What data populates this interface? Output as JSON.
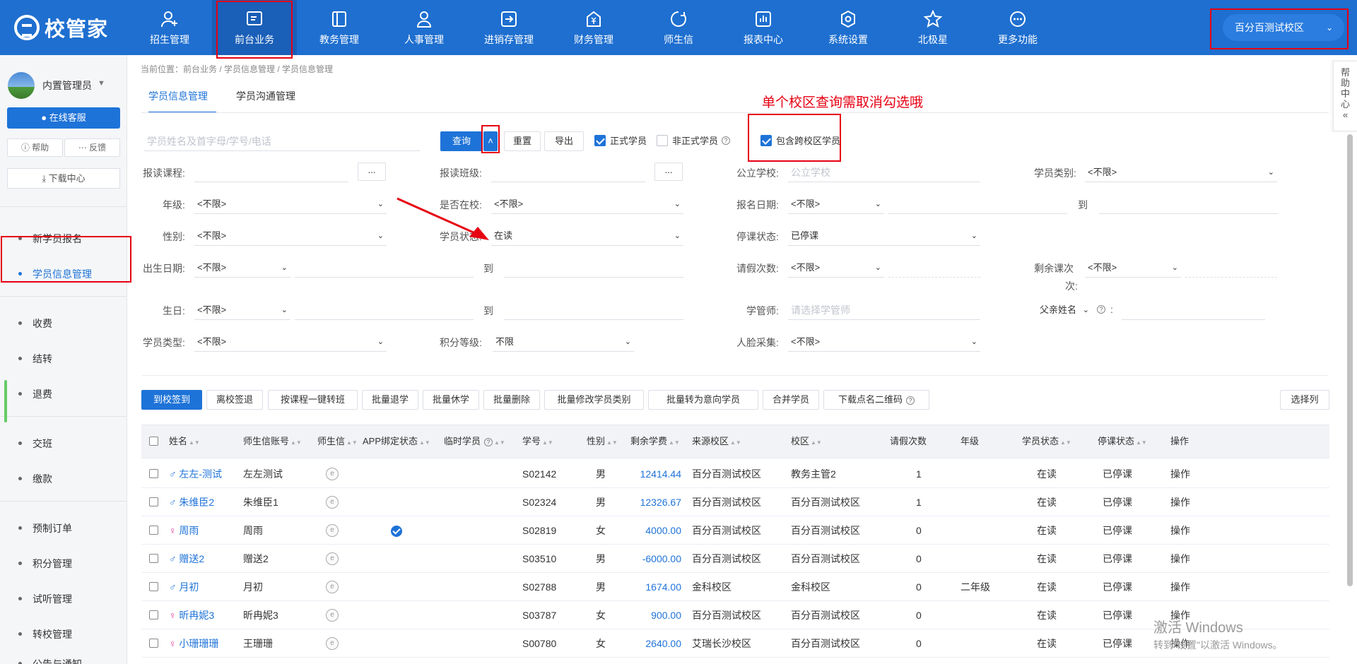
{
  "app": {
    "logo_text": "校管家"
  },
  "nav": [
    {
      "label": "招生管理",
      "icon": "person-add-icon"
    },
    {
      "label": "前台业务",
      "icon": "front-desk-icon",
      "active": true
    },
    {
      "label": "教务管理",
      "icon": "book-icon"
    },
    {
      "label": "人事管理",
      "icon": "person-icon"
    },
    {
      "label": "进销存管理",
      "icon": "inventory-icon"
    },
    {
      "label": "财务管理",
      "icon": "finance-icon"
    },
    {
      "label": "师生信",
      "icon": "message-icon"
    },
    {
      "label": "报表中心",
      "icon": "report-icon"
    },
    {
      "label": "系统设置",
      "icon": "settings-icon"
    },
    {
      "label": "北极星",
      "icon": "star-icon"
    },
    {
      "label": "更多功能",
      "icon": "more-icon"
    }
  ],
  "campus_selector": "百分百测试校区",
  "sidebar": {
    "user_name": "内置管理员",
    "online_service": "在线客服",
    "help": "帮助",
    "feedback": "反馈",
    "download_center": "下载中心",
    "items": [
      "新学员报名",
      "学员信息管理",
      "收费",
      "结转",
      "退费",
      "交班",
      "缴款",
      "预制订单",
      "积分管理",
      "试听管理",
      "转校管理",
      "公告与通知"
    ]
  },
  "breadcrumb": "当前位置：前台业务 / 学员信息管理 / 学员信息管理",
  "tabs": [
    "学员信息管理",
    "学员沟通管理"
  ],
  "annotation": "单个校区查询需取消勾选哦",
  "right_help": "帮助中心",
  "search": {
    "placeholder": "学员姓名及首字母/学号/电话",
    "query": "查询",
    "reset": "重置",
    "export": "导出",
    "formal": "正式学员",
    "informal": "非正式学员",
    "cross_campus": "包含跨校区学员"
  },
  "filters": {
    "course_label": "报读课程:",
    "class_label": "报读班级:",
    "dots": "...",
    "school_label": "公立学校:",
    "school_placeholder": "公立学校",
    "category_label": "学员类别:",
    "category_value": "<不限>",
    "grade_label": "年级:",
    "grade_value": "<不限>",
    "in_school_label": "是否在校:",
    "in_school_value": "<不限>",
    "signup_date_label": "报名日期:",
    "signup_date_value": "<不限>",
    "to": "到",
    "gender_label": "性别:",
    "gender_value": "<不限>",
    "status_label": "学员状态:",
    "status_value": "在读",
    "stop_label": "停课状态:",
    "stop_value": "已停课",
    "birthdate_label": "出生日期:",
    "birthdate_value": "<不限>",
    "leave_label": "请假次数:",
    "leave_value": "<不限>",
    "remain_label_1": "剩余课次",
    "remain_label_2": "次:",
    "remain_value": "<不限>",
    "birthday_label": "生日:",
    "birthday_value": "<不限>",
    "manager_label": "学管师:",
    "manager_placeholder": "请选择学管师",
    "father_value": "父亲姓名",
    "colon": ":",
    "type_label": "学员类型:",
    "type_value": "<不限>",
    "points_label": "积分等级:",
    "points_value": "不限",
    "face_label": "人脸采集:",
    "face_value": "<不限>"
  },
  "actions": [
    "到校签到",
    "离校签退",
    "按课程一键转班",
    "批量退学",
    "批量休学",
    "批量删除",
    "批量修改学员类别",
    "批量转为意向学员",
    "合并学员",
    "下载点名二维码"
  ],
  "select_columns": "选择列",
  "table": {
    "headers": [
      "姓名",
      "师生信账号",
      "师生信",
      "APP绑定状态",
      "临时学员",
      "学号",
      "性别",
      "剩余学费",
      "来源校区",
      "校区",
      "请假次数",
      "年级",
      "学员状态",
      "停课状态",
      "操作"
    ],
    "rows": [
      {
        "gender_icon": "male",
        "name": "左左-测试",
        "account": "左左测试",
        "bound": false,
        "id": "S02142",
        "gender": "男",
        "fee": "12414.44",
        "source": "百分百测试校区",
        "campus": "教务主管2",
        "leave": "1",
        "grade": "",
        "status": "在读",
        "stop": "已停课",
        "op": "操作"
      },
      {
        "gender_icon": "male",
        "name": "朱维臣2",
        "account": "朱维臣1",
        "bound": false,
        "id": "S02324",
        "gender": "男",
        "fee": "12326.67",
        "source": "百分百测试校区",
        "campus": "百分百测试校区",
        "leave": "1",
        "grade": "",
        "status": "在读",
        "stop": "已停课",
        "op": "操作"
      },
      {
        "gender_icon": "female",
        "name": "周雨",
        "account": "周雨",
        "bound": true,
        "id": "S02819",
        "gender": "女",
        "fee": "4000.00",
        "source": "百分百测试校区",
        "campus": "百分百测试校区",
        "leave": "0",
        "grade": "",
        "status": "在读",
        "stop": "已停课",
        "op": "操作"
      },
      {
        "gender_icon": "male",
        "name": "赠送2",
        "account": "赠送2",
        "bound": false,
        "id": "S03510",
        "gender": "男",
        "fee": "-6000.00",
        "source": "百分百测试校区",
        "campus": "百分百测试校区",
        "leave": "0",
        "grade": "",
        "status": "在读",
        "stop": "已停课",
        "op": "操作"
      },
      {
        "gender_icon": "male",
        "name": "月初",
        "account": "月初",
        "bound": false,
        "id": "S02788",
        "gender": "男",
        "fee": "1674.00",
        "source": "金科校区",
        "campus": "金科校区",
        "leave": "0",
        "grade": "二年级",
        "status": "在读",
        "stop": "已停课",
        "op": "操作"
      },
      {
        "gender_icon": "female",
        "name": "昕冉妮3",
        "account": "昕冉妮3",
        "bound": false,
        "id": "S03787",
        "gender": "女",
        "fee": "900.00",
        "source": "百分百测试校区",
        "campus": "百分百测试校区",
        "leave": "0",
        "grade": "",
        "status": "在读",
        "stop": "已停课",
        "op": "操作"
      },
      {
        "gender_icon": "female",
        "name": "小珊珊珊",
        "account": "王珊珊",
        "bound": false,
        "id": "S00780",
        "gender": "女",
        "fee": "2640.00",
        "source": "艾瑞长沙校区",
        "campus": "百分百测试校区",
        "leave": "0",
        "grade": "",
        "status": "在读",
        "stop": "已停课",
        "op": "操作"
      }
    ]
  },
  "watermark": {
    "line1": "激活 Windows",
    "line2": "转到\"设置\"以激活 Windows。"
  },
  "colors": {
    "brand": "#1e6fd0",
    "annotation": "#e60012",
    "link": "#1e73d8"
  }
}
